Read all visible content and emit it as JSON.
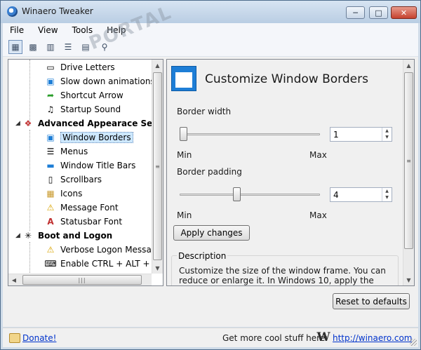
{
  "window": {
    "title": "Winaero Tweaker",
    "watermark": "PORTAL"
  },
  "menu": [
    "File",
    "View",
    "Tools",
    "Help"
  ],
  "tree": {
    "items": [
      {
        "type": "child",
        "label": "Drive Letters",
        "icon": "drive-icon"
      },
      {
        "type": "child",
        "label": "Slow down animations",
        "icon": "animation-icon"
      },
      {
        "type": "child",
        "label": "Shortcut Arrow",
        "icon": "shortcut-arrow-icon"
      },
      {
        "type": "child",
        "label": "Startup Sound",
        "icon": "speaker-icon"
      },
      {
        "type": "category",
        "label": "Advanced Appearace Settin",
        "icon": "palette-icon"
      },
      {
        "type": "child",
        "label": "Window Borders",
        "icon": "window-borders-icon",
        "selected": true
      },
      {
        "type": "child",
        "label": "Menus",
        "icon": "menu-icon"
      },
      {
        "type": "child",
        "label": "Window Title Bars",
        "icon": "title-bar-icon"
      },
      {
        "type": "child",
        "label": "Scrollbars",
        "icon": "scrollbar-icon"
      },
      {
        "type": "child",
        "label": "Icons",
        "icon": "icons-icon"
      },
      {
        "type": "child",
        "label": "Message Font",
        "icon": "warning-icon"
      },
      {
        "type": "child",
        "label": "Statusbar Font",
        "icon": "font-icon"
      },
      {
        "type": "category",
        "label": "Boot and Logon",
        "icon": "boot-icon"
      },
      {
        "type": "child",
        "label": "Verbose Logon Messages",
        "icon": "warning-icon"
      },
      {
        "type": "child",
        "label": "Enable CTRL + ALT + DEL",
        "icon": "keyboard-icon"
      }
    ]
  },
  "panel": {
    "title": "Customize Window Borders",
    "border_width": {
      "label": "Border width",
      "value": "1",
      "level": 0.0
    },
    "border_padding": {
      "label": "Border padding",
      "value": "4",
      "level": 0.4
    },
    "min_label": "Min",
    "max_label": "Max",
    "apply_label": "Apply changes",
    "description_label": "Description",
    "description_text": "Customize the size of the window frame. You can reduce or enlarge it. In Windows 10, apply the Aero Lite theme to get"
  },
  "reset_label": "Reset to defaults",
  "status": {
    "donate_label": "Donate!",
    "more_text": "Get more cool stuff here:",
    "logo_letter": "W",
    "site_link": "http://winaero.com"
  },
  "colors": {
    "accent": "#1e7ed6",
    "selection": "#cde8ff",
    "link": "#0033cc"
  }
}
